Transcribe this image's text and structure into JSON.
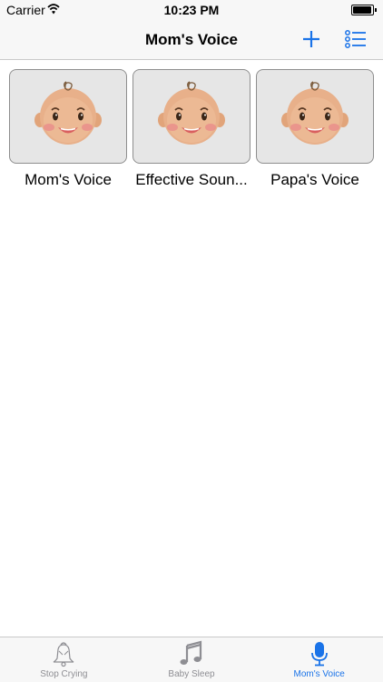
{
  "status": {
    "carrier": "Carrier",
    "time": "10:23 PM",
    "battery_level": 0.95
  },
  "nav": {
    "title": "Mom's Voice",
    "add_icon": "plus-icon",
    "list_icon": "list-icon"
  },
  "tiles": [
    {
      "label": "Mom's Voice",
      "icon": "baby-face-icon"
    },
    {
      "label": "Effective Soun...",
      "icon": "baby-face-icon"
    },
    {
      "label": "Papa's Voice",
      "icon": "baby-face-icon"
    }
  ],
  "tabs": [
    {
      "label": "Stop Crying",
      "icon": "bell-icon",
      "active": false
    },
    {
      "label": "Baby Sleep",
      "icon": "music-note-icon",
      "active": false
    },
    {
      "label": "Mom's Voice",
      "icon": "microphone-icon",
      "active": true
    }
  ],
  "colors": {
    "accent": "#1a73e8",
    "tile_bg": "#e6e6e6",
    "bar_bg": "#f7f7f7",
    "inactive": "#8e8e93"
  }
}
